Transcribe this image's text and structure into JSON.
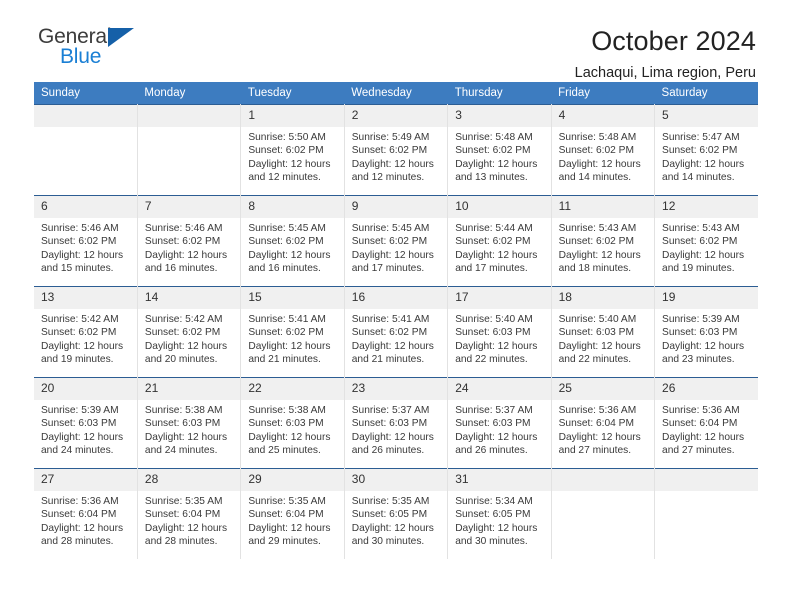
{
  "logo": {
    "word1": "General",
    "word2": "Blue",
    "triangle_color": "#1560a8",
    "blue_color": "#1a7fd4"
  },
  "header": {
    "title": "October 2024",
    "subtitle": "Lachaqui, Lima region, Peru"
  },
  "theme": {
    "header_bg": "#3d7cc0",
    "header_text": "#ffffff",
    "row_border": "#2c5d93",
    "daynum_bg": "#f0f0f0"
  },
  "calendar": {
    "weekday_headers": [
      "Sunday",
      "Monday",
      "Tuesday",
      "Wednesday",
      "Thursday",
      "Friday",
      "Saturday"
    ],
    "weeks": [
      [
        {
          "day": "",
          "blank": true
        },
        {
          "day": "",
          "blank": true
        },
        {
          "day": "1",
          "sunrise": "Sunrise: 5:50 AM",
          "sunset": "Sunset: 6:02 PM",
          "daylight_l1": "Daylight: 12 hours",
          "daylight_l2": "and 12 minutes."
        },
        {
          "day": "2",
          "sunrise": "Sunrise: 5:49 AM",
          "sunset": "Sunset: 6:02 PM",
          "daylight_l1": "Daylight: 12 hours",
          "daylight_l2": "and 12 minutes."
        },
        {
          "day": "3",
          "sunrise": "Sunrise: 5:48 AM",
          "sunset": "Sunset: 6:02 PM",
          "daylight_l1": "Daylight: 12 hours",
          "daylight_l2": "and 13 minutes."
        },
        {
          "day": "4",
          "sunrise": "Sunrise: 5:48 AM",
          "sunset": "Sunset: 6:02 PM",
          "daylight_l1": "Daylight: 12 hours",
          "daylight_l2": "and 14 minutes."
        },
        {
          "day": "5",
          "sunrise": "Sunrise: 5:47 AM",
          "sunset": "Sunset: 6:02 PM",
          "daylight_l1": "Daylight: 12 hours",
          "daylight_l2": "and 14 minutes."
        }
      ],
      [
        {
          "day": "6",
          "sunrise": "Sunrise: 5:46 AM",
          "sunset": "Sunset: 6:02 PM",
          "daylight_l1": "Daylight: 12 hours",
          "daylight_l2": "and 15 minutes."
        },
        {
          "day": "7",
          "sunrise": "Sunrise: 5:46 AM",
          "sunset": "Sunset: 6:02 PM",
          "daylight_l1": "Daylight: 12 hours",
          "daylight_l2": "and 16 minutes."
        },
        {
          "day": "8",
          "sunrise": "Sunrise: 5:45 AM",
          "sunset": "Sunset: 6:02 PM",
          "daylight_l1": "Daylight: 12 hours",
          "daylight_l2": "and 16 minutes."
        },
        {
          "day": "9",
          "sunrise": "Sunrise: 5:45 AM",
          "sunset": "Sunset: 6:02 PM",
          "daylight_l1": "Daylight: 12 hours",
          "daylight_l2": "and 17 minutes."
        },
        {
          "day": "10",
          "sunrise": "Sunrise: 5:44 AM",
          "sunset": "Sunset: 6:02 PM",
          "daylight_l1": "Daylight: 12 hours",
          "daylight_l2": "and 17 minutes."
        },
        {
          "day": "11",
          "sunrise": "Sunrise: 5:43 AM",
          "sunset": "Sunset: 6:02 PM",
          "daylight_l1": "Daylight: 12 hours",
          "daylight_l2": "and 18 minutes."
        },
        {
          "day": "12",
          "sunrise": "Sunrise: 5:43 AM",
          "sunset": "Sunset: 6:02 PM",
          "daylight_l1": "Daylight: 12 hours",
          "daylight_l2": "and 19 minutes."
        }
      ],
      [
        {
          "day": "13",
          "sunrise": "Sunrise: 5:42 AM",
          "sunset": "Sunset: 6:02 PM",
          "daylight_l1": "Daylight: 12 hours",
          "daylight_l2": "and 19 minutes."
        },
        {
          "day": "14",
          "sunrise": "Sunrise: 5:42 AM",
          "sunset": "Sunset: 6:02 PM",
          "daylight_l1": "Daylight: 12 hours",
          "daylight_l2": "and 20 minutes."
        },
        {
          "day": "15",
          "sunrise": "Sunrise: 5:41 AM",
          "sunset": "Sunset: 6:02 PM",
          "daylight_l1": "Daylight: 12 hours",
          "daylight_l2": "and 21 minutes."
        },
        {
          "day": "16",
          "sunrise": "Sunrise: 5:41 AM",
          "sunset": "Sunset: 6:02 PM",
          "daylight_l1": "Daylight: 12 hours",
          "daylight_l2": "and 21 minutes."
        },
        {
          "day": "17",
          "sunrise": "Sunrise: 5:40 AM",
          "sunset": "Sunset: 6:03 PM",
          "daylight_l1": "Daylight: 12 hours",
          "daylight_l2": "and 22 minutes."
        },
        {
          "day": "18",
          "sunrise": "Sunrise: 5:40 AM",
          "sunset": "Sunset: 6:03 PM",
          "daylight_l1": "Daylight: 12 hours",
          "daylight_l2": "and 22 minutes."
        },
        {
          "day": "19",
          "sunrise": "Sunrise: 5:39 AM",
          "sunset": "Sunset: 6:03 PM",
          "daylight_l1": "Daylight: 12 hours",
          "daylight_l2": "and 23 minutes."
        }
      ],
      [
        {
          "day": "20",
          "sunrise": "Sunrise: 5:39 AM",
          "sunset": "Sunset: 6:03 PM",
          "daylight_l1": "Daylight: 12 hours",
          "daylight_l2": "and 24 minutes."
        },
        {
          "day": "21",
          "sunrise": "Sunrise: 5:38 AM",
          "sunset": "Sunset: 6:03 PM",
          "daylight_l1": "Daylight: 12 hours",
          "daylight_l2": "and 24 minutes."
        },
        {
          "day": "22",
          "sunrise": "Sunrise: 5:38 AM",
          "sunset": "Sunset: 6:03 PM",
          "daylight_l1": "Daylight: 12 hours",
          "daylight_l2": "and 25 minutes."
        },
        {
          "day": "23",
          "sunrise": "Sunrise: 5:37 AM",
          "sunset": "Sunset: 6:03 PM",
          "daylight_l1": "Daylight: 12 hours",
          "daylight_l2": "and 26 minutes."
        },
        {
          "day": "24",
          "sunrise": "Sunrise: 5:37 AM",
          "sunset": "Sunset: 6:03 PM",
          "daylight_l1": "Daylight: 12 hours",
          "daylight_l2": "and 26 minutes."
        },
        {
          "day": "25",
          "sunrise": "Sunrise: 5:36 AM",
          "sunset": "Sunset: 6:04 PM",
          "daylight_l1": "Daylight: 12 hours",
          "daylight_l2": "and 27 minutes."
        },
        {
          "day": "26",
          "sunrise": "Sunrise: 5:36 AM",
          "sunset": "Sunset: 6:04 PM",
          "daylight_l1": "Daylight: 12 hours",
          "daylight_l2": "and 27 minutes."
        }
      ],
      [
        {
          "day": "27",
          "sunrise": "Sunrise: 5:36 AM",
          "sunset": "Sunset: 6:04 PM",
          "daylight_l1": "Daylight: 12 hours",
          "daylight_l2": "and 28 minutes."
        },
        {
          "day": "28",
          "sunrise": "Sunrise: 5:35 AM",
          "sunset": "Sunset: 6:04 PM",
          "daylight_l1": "Daylight: 12 hours",
          "daylight_l2": "and 28 minutes."
        },
        {
          "day": "29",
          "sunrise": "Sunrise: 5:35 AM",
          "sunset": "Sunset: 6:04 PM",
          "daylight_l1": "Daylight: 12 hours",
          "daylight_l2": "and 29 minutes."
        },
        {
          "day": "30",
          "sunrise": "Sunrise: 5:35 AM",
          "sunset": "Sunset: 6:05 PM",
          "daylight_l1": "Daylight: 12 hours",
          "daylight_l2": "and 30 minutes."
        },
        {
          "day": "31",
          "sunrise": "Sunrise: 5:34 AM",
          "sunset": "Sunset: 6:05 PM",
          "daylight_l1": "Daylight: 12 hours",
          "daylight_l2": "and 30 minutes."
        },
        {
          "day": "",
          "blank": true
        },
        {
          "day": "",
          "blank": true
        }
      ]
    ]
  }
}
